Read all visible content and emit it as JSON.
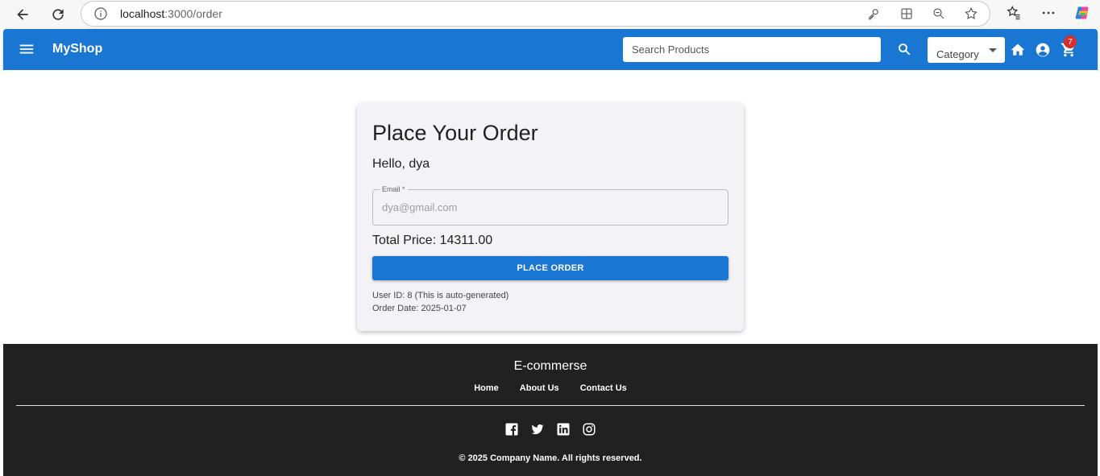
{
  "browser": {
    "url_host": "localhost",
    "url_path": ":3000/order"
  },
  "appbar": {
    "brand": "MyShop",
    "search_placeholder": "Search Products",
    "category_label": "Category",
    "cart_count": "7",
    "color": "#1976d2"
  },
  "order": {
    "title": "Place Your Order",
    "greeting": "Hello, dya",
    "email_label": "Email *",
    "email_value": "dya@gmail.com",
    "total": "Total Price: 14311.00",
    "button_label": "PLACE ORDER",
    "user_id": "User ID: 8 (This is auto-generated)",
    "order_date": "Order Date: 2025-01-07"
  },
  "footer": {
    "title": "E-commerse",
    "links": [
      "Home",
      "About Us",
      "Contact Us"
    ],
    "social_icons": [
      "facebook-icon",
      "twitter-icon",
      "linkedin-icon",
      "instagram-icon"
    ],
    "copyright": "© 2025 Company Name. All rights reserved."
  }
}
